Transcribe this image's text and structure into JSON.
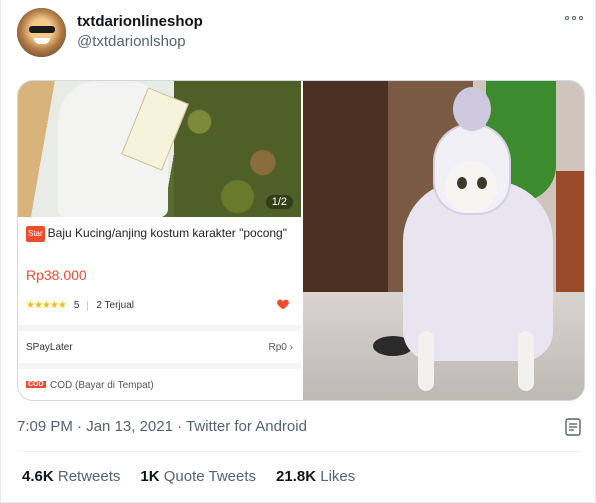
{
  "author": {
    "name": "txtdarionlineshop",
    "handle": "@txtdarionlshop"
  },
  "media": {
    "product": {
      "image_counter": "1/2",
      "star_badge": "Star",
      "title": "Baju Kucing/anjing kostum karakter \"pocong\"",
      "price": "Rp38.000",
      "rating": "5",
      "sold": "2 Terjual",
      "paylater_label": "SPayLater",
      "paylater_value": "Rp0",
      "cod_badge": "COD",
      "cod_label": "COD (Bayar di Tempat)"
    }
  },
  "meta": {
    "time": "7:09 PM",
    "date": "Jan 13, 2021",
    "source": "Twitter for Android"
  },
  "stats": {
    "retweets_count": "4.6K",
    "retweets_label": "Retweets",
    "quotes_count": "1K",
    "quotes_label": "Quote Tweets",
    "likes_count": "21.8K",
    "likes_label": "Likes"
  },
  "colors": {
    "accent": "#ee4d2d",
    "muted": "#536471"
  }
}
